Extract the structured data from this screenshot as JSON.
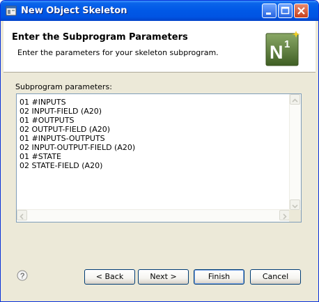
{
  "window": {
    "title": "New Object Skeleton",
    "controls": [
      "minimize-icon",
      "maximize-icon",
      "close-icon"
    ]
  },
  "header": {
    "title": "Enter the Subprogram Parameters",
    "description": "Enter the parameters for your skeleton subprogram.",
    "logo_letter": "N",
    "logo_superscript": "1"
  },
  "params": {
    "label": "Subprogram parameters:",
    "text": "01 #INPUTS\n02 INPUT-FIELD (A20)\n01 #OUTPUTS\n02 OUTPUT-FIELD (A20)\n01 #INPUTS-OUTPUTS\n02 INPUT-OUTPUT-FIELD (A20)\n01 #STATE\n02 STATE-FIELD (A20)"
  },
  "buttons": {
    "back": "< Back",
    "next": "Next >",
    "finish": "Finish",
    "cancel": "Cancel"
  },
  "help": {
    "icon": "help-icon",
    "glyph": "?"
  },
  "colors": {
    "titlebar": "#0054e3",
    "dialog_bg": "#ece9d8",
    "logo_bg": "#5a7a3a"
  }
}
